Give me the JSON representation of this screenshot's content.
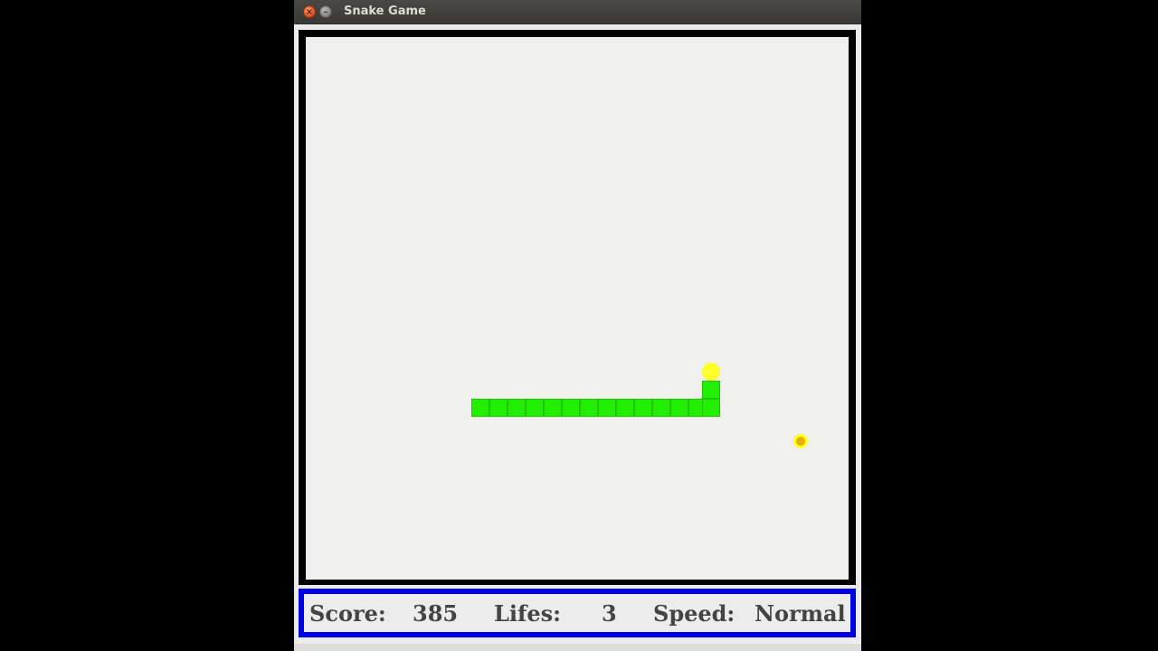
{
  "window": {
    "title": "Snake Game"
  },
  "titlebar": {
    "close_glyph": "×",
    "minimize_glyph": "–",
    "close_icon": "close-icon",
    "minimize_icon": "minimize-icon"
  },
  "game": {
    "snake_color": "#22ee00",
    "head_color": "#ffff2a",
    "food_color": "#e6b000",
    "board_color": "#efefed",
    "frame_color": "#000000"
  },
  "status": {
    "score_label": "Score:",
    "score_value": "385",
    "lifes_label": "Lifes:",
    "lifes_value": "3",
    "speed_label": "Speed:",
    "speed_value": "Normal",
    "border_color": "#0000e8"
  }
}
